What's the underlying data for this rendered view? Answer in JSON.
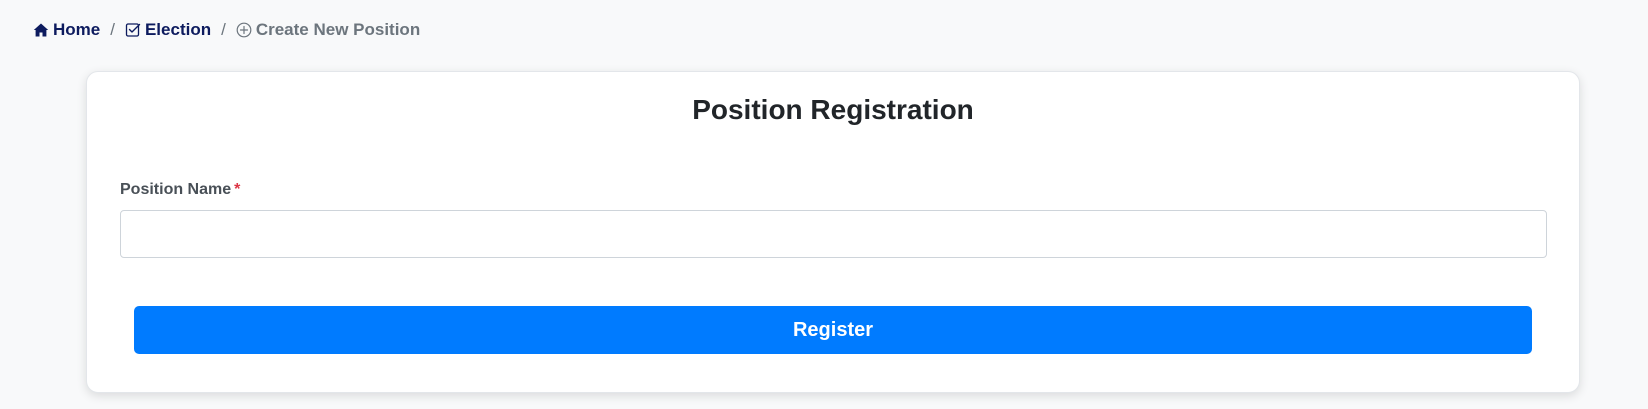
{
  "breadcrumb": {
    "items": [
      {
        "label": "Home",
        "icon": "home-icon"
      },
      {
        "label": "Election",
        "icon": "checkbox-icon"
      },
      {
        "label": "Create New Position",
        "icon": "plus-circle-icon"
      }
    ],
    "separator": "/"
  },
  "form": {
    "title": "Position Registration",
    "position_name_label": "Position Name",
    "required_marker": "*",
    "position_name_value": "",
    "position_name_placeholder": "",
    "submit_label": "Register"
  },
  "colors": {
    "primary": "#007bff",
    "breadcrumb_link": "#0d1b5e",
    "required": "#dc3545",
    "background": "#f8f9fa"
  }
}
